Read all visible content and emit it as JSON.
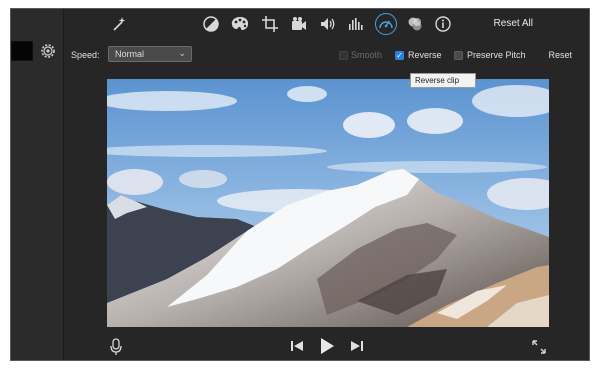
{
  "toolbar": {
    "reset_all_label": "Reset All",
    "icons": [
      "magic-wand-icon",
      "color-balance-icon",
      "color-palette-icon",
      "crop-icon",
      "video-camera-icon",
      "volume-icon",
      "equalizer-icon",
      "speedometer-icon",
      "filter-overlay-icon",
      "info-icon"
    ],
    "active_icon": "speedometer-icon"
  },
  "speed_panel": {
    "speed_label": "Speed:",
    "speed_value": "Normal",
    "smooth_label": "Smooth",
    "smooth_enabled": false,
    "reverse_label": "Reverse",
    "reverse_checked": true,
    "preserve_pitch_label": "Preserve Pitch",
    "preserve_pitch_checked": false,
    "reset_label": "Reset"
  },
  "tooltip": {
    "text": "Reverse clip"
  },
  "playback": {
    "controls": [
      "microphone-icon",
      "skip-back-icon",
      "play-icon",
      "skip-forward-icon",
      "expand-icon"
    ]
  },
  "colors": {
    "accent": "#2f7ee6",
    "active_ring": "#4aa0e0",
    "background": "#262626"
  }
}
